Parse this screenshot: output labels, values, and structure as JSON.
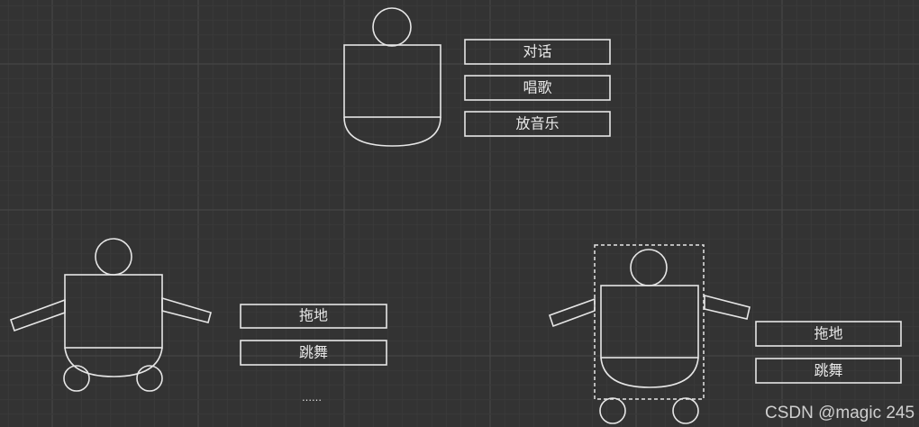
{
  "colors": {
    "background": "#333333",
    "stroke": "#e6e6e6",
    "grid_minor": "#3a3a3a",
    "grid_major": "#484848"
  },
  "robot_top": {
    "actions": [
      "对话",
      "唱歌",
      "放音乐"
    ]
  },
  "robot_bottom_left": {
    "actions": [
      "拖地",
      "跳舞"
    ],
    "ellipsis": "……"
  },
  "robot_bottom_right": {
    "actions": [
      "拖地",
      "跳舞"
    ]
  },
  "watermark": "CSDN @magic 245"
}
